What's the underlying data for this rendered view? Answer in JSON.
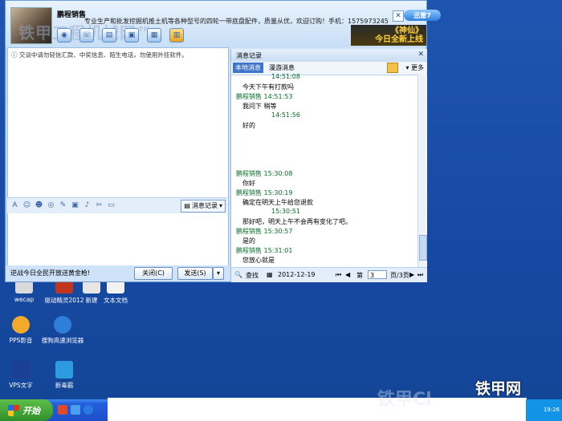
{
  "window": {
    "contact_name": "鹏程销售",
    "signature": "专业生产和批发挖掘机推土机等各种型号的四轮一带底盘配件，质量从优，欢迎订购！手机：1575973245",
    "watermark": "铁甲工程机械网™",
    "watermark_url": "tieJiA.com",
    "xunlei_label": "迅雷7",
    "game_banner_line1": "《神仙》",
    "game_banner_line2": "今日全新上线",
    "close_glyph": "✕"
  },
  "chat": {
    "notice": "交谈中请勿轻信汇款、中奖信息、陌生电话，勿使用外挂软件。",
    "history_button": "消息记录",
    "ad_text": "逆战今日全民开放送黄金枪!",
    "close_button": "关闭(C)",
    "send_button": "发送(S)"
  },
  "history": {
    "title": "消息记录",
    "tab_local": "本地消息",
    "tab_roam": "漫游消息",
    "more": "更多",
    "search": "查找",
    "date": "2012-12-19",
    "page_label": "第",
    "page_value": "3",
    "page_total": "页/3页",
    "messages": [
      {
        "kind": "time",
        "text": "14:51:08"
      },
      {
        "kind": "text",
        "text": "今天下午有打款吗"
      },
      {
        "kind": "sender",
        "text": "鹏程销售",
        "time": "14:51:53"
      },
      {
        "kind": "text",
        "text": "我问下   稍等"
      },
      {
        "kind": "time",
        "text": "14:51:56"
      },
      {
        "kind": "text",
        "text": "好的"
      },
      {
        "kind": "sender",
        "text": "鹏程销售",
        "time": "15:30:08"
      },
      {
        "kind": "text",
        "text": "你好"
      },
      {
        "kind": "sender",
        "text": "鹏程销售",
        "time": "15:30:19"
      },
      {
        "kind": "text",
        "text": "确定在明天上午给您退款"
      },
      {
        "kind": "time",
        "text": "15:30:51"
      },
      {
        "kind": "text",
        "text": "那好吧，明天上午不会再有变化了吧。"
      },
      {
        "kind": "sender",
        "text": "鹏程销售",
        "time": "15:30:57"
      },
      {
        "kind": "text",
        "text": "是的"
      },
      {
        "kind": "sender",
        "text": "鹏程销售",
        "time": "15:31:01"
      },
      {
        "kind": "text",
        "text": "您放心就是"
      }
    ]
  },
  "desktop": {
    "icons": [
      {
        "label": "wecap"
      },
      {
        "label": "驱动精灵2012"
      },
      {
        "label": "新建"
      },
      {
        "label": "文本文档"
      },
      {
        "label": "PPS影音"
      },
      {
        "label": "搜狗高速浏览器"
      },
      {
        "label": "VPS文字"
      },
      {
        "label": "新毒霸"
      }
    ]
  },
  "taskbar": {
    "start_label": "开始",
    "clock": "19:26"
  },
  "branding": {
    "logo_text": "铁甲网",
    "faded_text": "铁甲Cl"
  }
}
